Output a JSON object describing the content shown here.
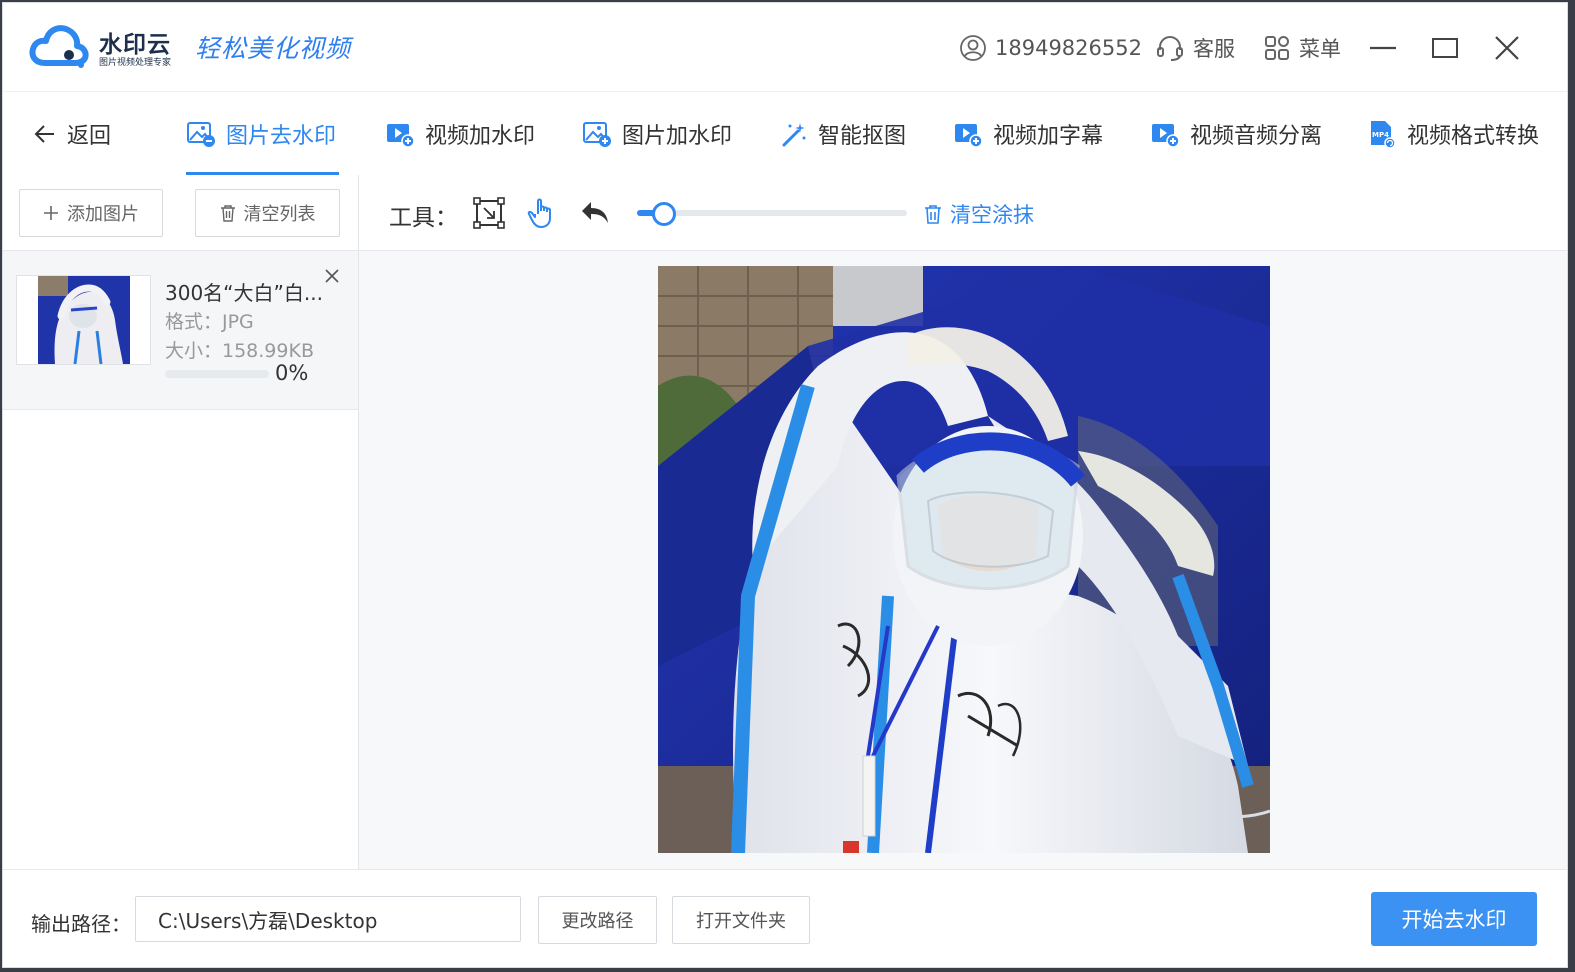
{
  "app": {
    "brand_name": "水印云",
    "brand_subtitle": "图片视频处理专家",
    "slogan": "轻松美化视频"
  },
  "titlebar": {
    "account_number": "18949826552",
    "support_label": "客服",
    "menu_label": "菜单"
  },
  "nav": {
    "back_label": "返回",
    "tabs": [
      {
        "label": "图片去水印",
        "icon": "image-remove-icon",
        "active": true
      },
      {
        "label": "视频加水印",
        "icon": "video-add-icon",
        "active": false
      },
      {
        "label": "图片加水印",
        "icon": "image-add-icon",
        "active": false
      },
      {
        "label": "智能抠图",
        "icon": "magic-wand-icon",
        "active": false
      },
      {
        "label": "视频加字幕",
        "icon": "video-subtitle-icon",
        "active": false
      },
      {
        "label": "视频音频分离",
        "icon": "video-audio-split-icon",
        "active": false
      },
      {
        "label": "视频格式转换",
        "icon": "mp4-convert-icon",
        "active": false
      }
    ]
  },
  "left_panel": {
    "add_image_label": "添加图片",
    "clear_list_label": "清空列表",
    "files": [
      {
        "name": "300名“大白”白...",
        "format": "格式：JPG",
        "size": "大小：158.99KB",
        "progress_text": "0%",
        "progress": 0
      }
    ]
  },
  "toolbar": {
    "tools_label": "工具：",
    "brush_size": 0.1,
    "clear_smear_label": "清空涂抹"
  },
  "footer": {
    "output_path_label": "输出路径：",
    "output_path_value": "C:\\Users\\方磊\\Desktop",
    "change_path_label": "更改路径",
    "open_folder_label": "打开文件夹",
    "start_label": "开始去水印"
  },
  "colors": {
    "accent": "#2f87f0",
    "start_button": "#3b92f2",
    "brand_dark": "#1d2f4d"
  }
}
